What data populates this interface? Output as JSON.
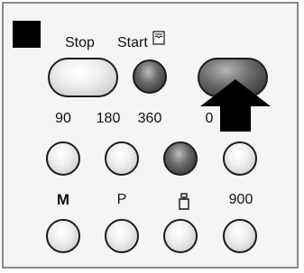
{
  "controls": {
    "stop_label": "Stop",
    "start_label": "Start",
    "row_labels": [
      "90",
      "180",
      "360",
      "0"
    ],
    "mode_labels": [
      "M",
      "P",
      "900"
    ]
  },
  "icons": {
    "start_corner_icon": "document-icon",
    "tare_icon": "weight-icon",
    "pointer": "arrow-up-icon"
  },
  "colors": {
    "panel_bg": "#f5f5f5",
    "panel_border": "#8a8a8a",
    "indicator": "#000000",
    "button_light": "#e8e8e8",
    "button_dark": "#4a4a4a"
  }
}
